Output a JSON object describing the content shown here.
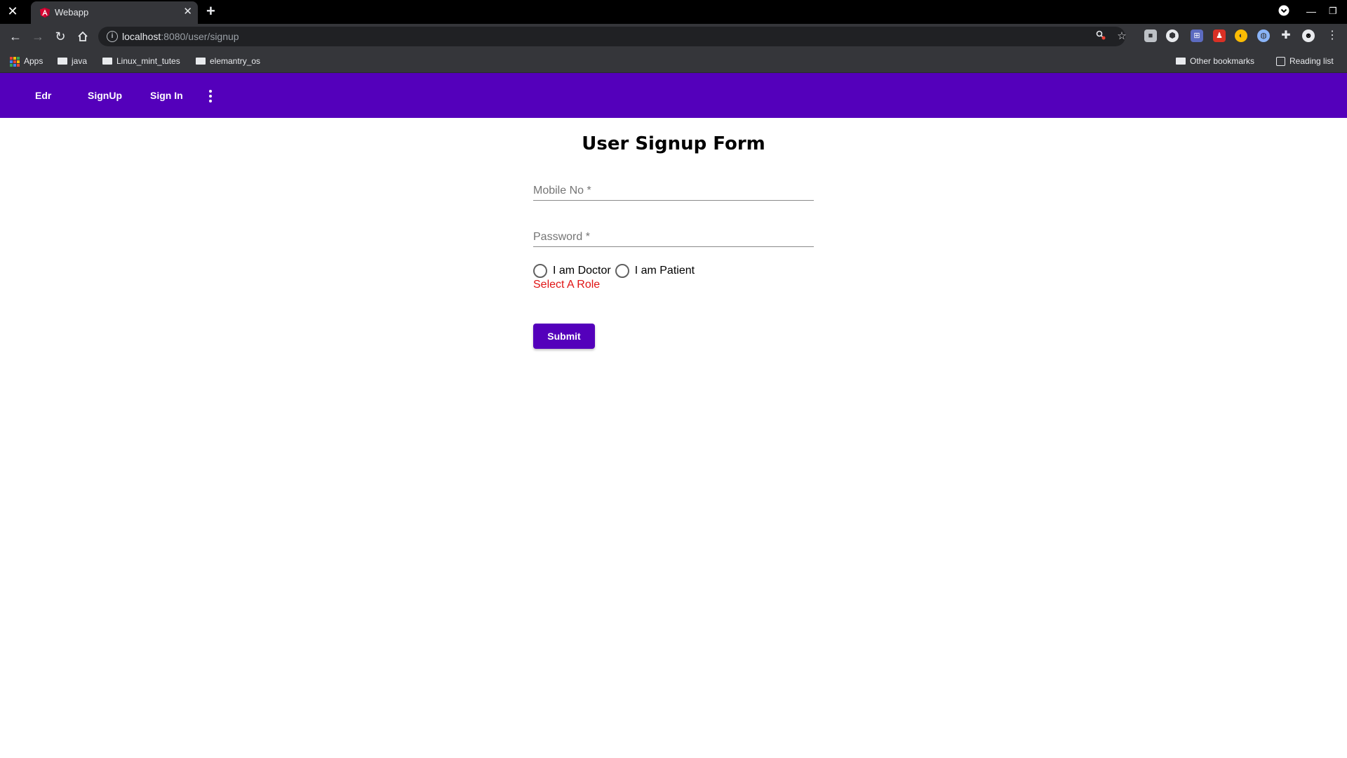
{
  "browser": {
    "tab": {
      "title": "Webapp"
    },
    "url": {
      "host": "localhost",
      "path": ":8080/user/signup"
    },
    "bookmarks": {
      "apps": "Apps",
      "items": [
        "java",
        "Linux_mint_tutes",
        "elemantry_os"
      ],
      "other": "Other bookmarks",
      "reading_list": "Reading list"
    }
  },
  "appbar": {
    "color": "#5400bb",
    "links": [
      "Edr",
      "SignUp",
      "Sign In"
    ]
  },
  "form": {
    "title": "User Signup Form",
    "mobile_placeholder": "Mobile No *",
    "password_placeholder": "Password *",
    "roles": [
      "I am Doctor",
      "I am Patient"
    ],
    "error": "Select A Role",
    "submit": "Submit"
  }
}
